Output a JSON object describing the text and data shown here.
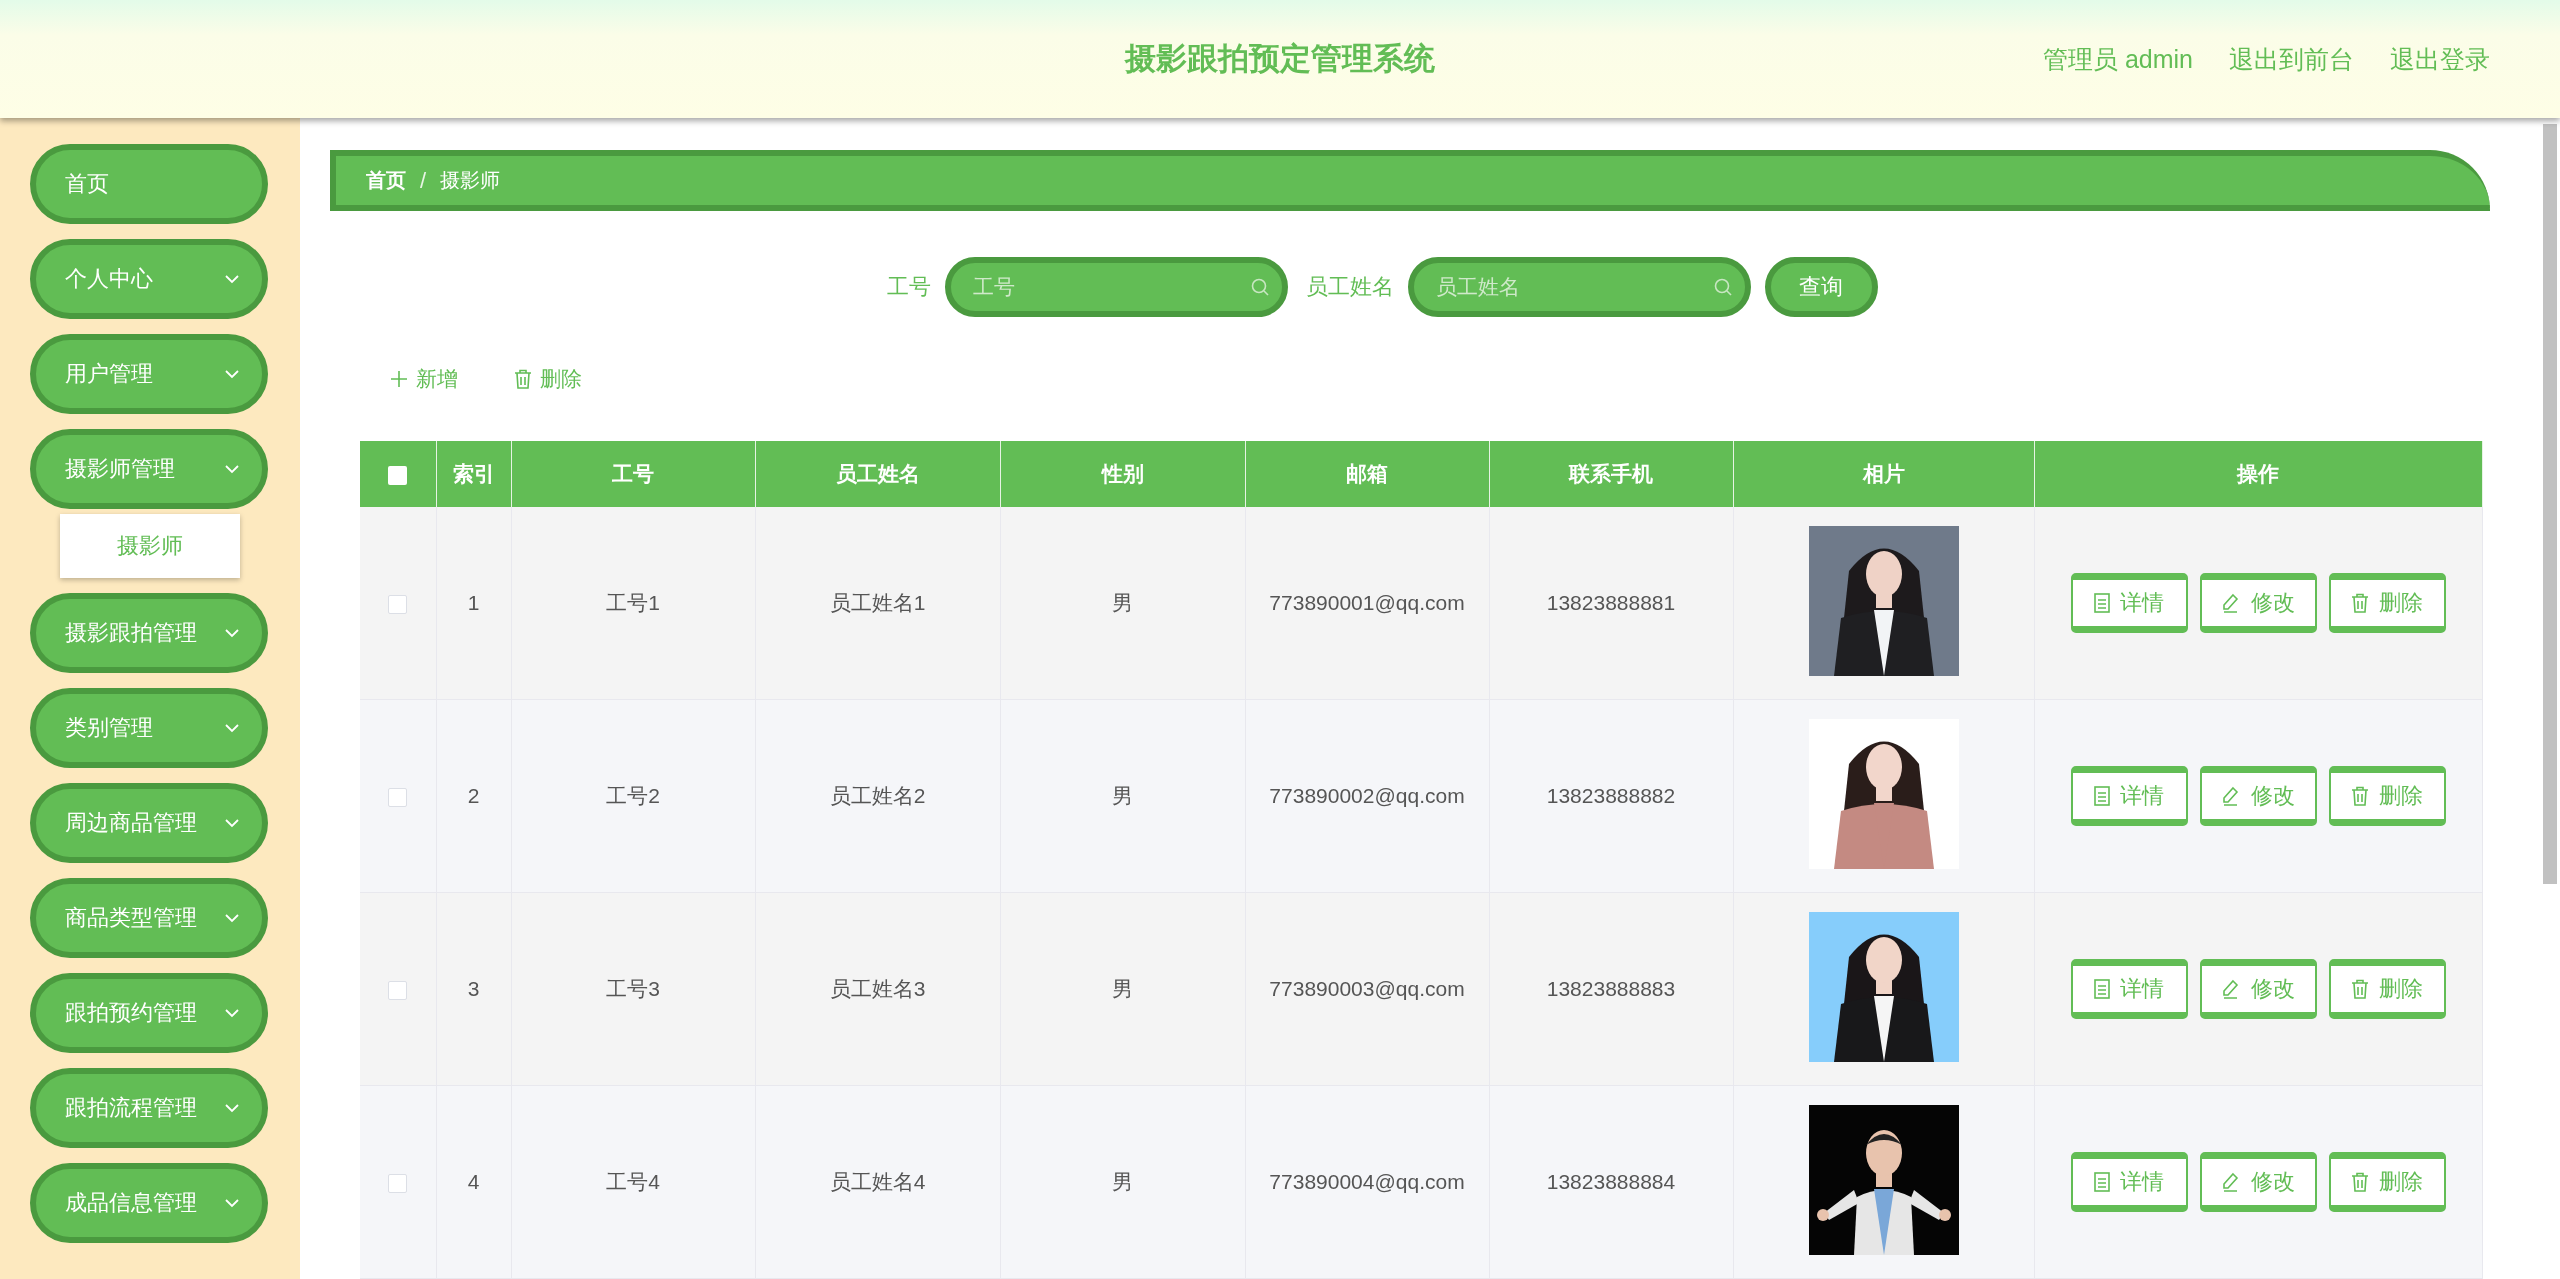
{
  "header": {
    "title": "摄影跟拍预定管理系统",
    "links": [
      "管理员 admin",
      "退出到前台",
      "退出登录"
    ]
  },
  "sidebar": {
    "items": [
      {
        "label": "首页",
        "kind": "link"
      },
      {
        "label": "个人中心",
        "kind": "menu"
      },
      {
        "label": "用户管理",
        "kind": "menu"
      },
      {
        "label": "摄影师管理",
        "kind": "menu",
        "children": [
          {
            "label": "摄影师"
          }
        ]
      },
      {
        "label": "摄影跟拍管理",
        "kind": "menu"
      },
      {
        "label": "类别管理",
        "kind": "menu"
      },
      {
        "label": "周边商品管理",
        "kind": "menu"
      },
      {
        "label": "商品类型管理",
        "kind": "menu"
      },
      {
        "label": "跟拍预约管理",
        "kind": "menu"
      },
      {
        "label": "跟拍流程管理",
        "kind": "menu"
      },
      {
        "label": "成品信息管理",
        "kind": "menu"
      }
    ]
  },
  "breadcrumb": {
    "separator": "/",
    "items": [
      "首页",
      "摄影师"
    ]
  },
  "search": {
    "fields": [
      {
        "label": "工号",
        "placeholder": "工号"
      },
      {
        "label": "员工姓名",
        "placeholder": "员工姓名"
      }
    ],
    "button": "查询"
  },
  "actions": [
    {
      "kind": "add",
      "label": "新增"
    },
    {
      "kind": "delete",
      "label": "删除"
    }
  ],
  "table": {
    "select_all_checked": false,
    "columns": [
      "索引",
      "工号",
      "员工姓名",
      "性别",
      "邮箱",
      "联系手机",
      "相片",
      "操作"
    ],
    "rows": [
      {
        "checked": false,
        "cells": [
          "1",
          "工号1",
          "员工姓名1",
          "男",
          "773890001@qq.com",
          "13823888881"
        ],
        "photo": {
          "kind": "picture"
        },
        "buttons": [
          {
            "kind": "detail",
            "label": "详情"
          },
          {
            "kind": "edit",
            "label": "修改"
          },
          {
            "kind": "delete",
            "label": "删除"
          }
        ]
      },
      {
        "checked": false,
        "cells": [
          "2",
          "工号2",
          "员工姓名2",
          "男",
          "773890002@qq.com",
          "13823888882"
        ],
        "photo": {
          "kind": "picture"
        },
        "buttons": [
          {
            "kind": "detail",
            "label": "详情"
          },
          {
            "kind": "edit",
            "label": "修改"
          },
          {
            "kind": "delete",
            "label": "删除"
          }
        ]
      },
      {
        "checked": false,
        "cells": [
          "3",
          "工号3",
          "员工姓名3",
          "男",
          "773890003@qq.com",
          "13823888883"
        ],
        "photo": {
          "kind": "picture"
        },
        "buttons": [
          {
            "kind": "detail",
            "label": "详情"
          },
          {
            "kind": "edit",
            "label": "修改"
          },
          {
            "kind": "delete",
            "label": "删除"
          }
        ]
      },
      {
        "checked": false,
        "cells": [
          "4",
          "工号4",
          "员工姓名4",
          "男",
          "773890004@qq.com",
          "13823888884"
        ],
        "photo": {
          "kind": "picture"
        },
        "buttons": [
          {
            "kind": "detail",
            "label": "详情"
          },
          {
            "kind": "edit",
            "label": "修改"
          },
          {
            "kind": "delete",
            "label": "删除"
          }
        ]
      }
    ]
  }
}
